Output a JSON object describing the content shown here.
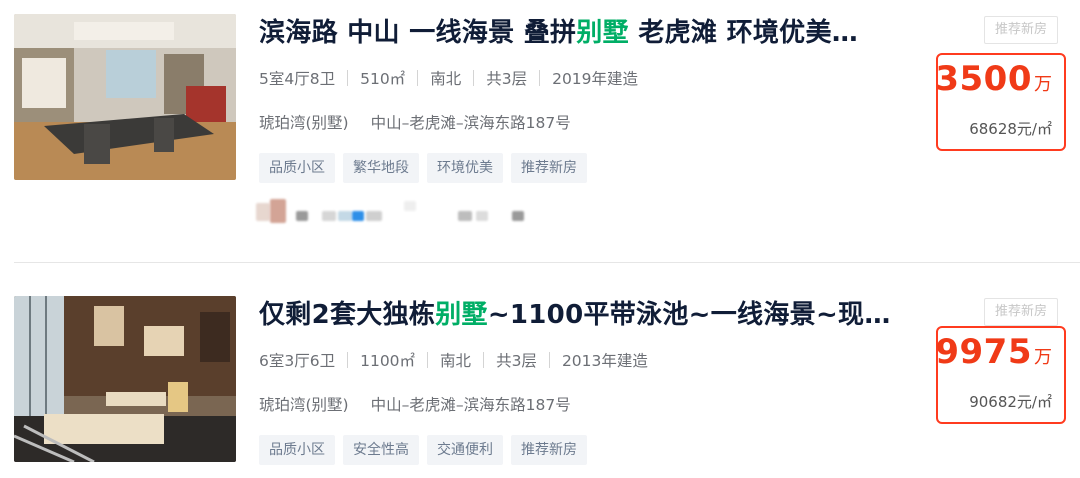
{
  "listings": [
    {
      "title_before": "滨海路 中山 一线海景 叠拼",
      "title_highlight": "别墅",
      "title_after": " 老虎滩 环境优美…",
      "badge": "推荐新房",
      "layout": "5室4厅8卫",
      "area": "510㎡",
      "orientation": "南北",
      "floors": "共3层",
      "year": "2019年建造",
      "community": "琥珀湾(别墅)",
      "location": "中山–老虎滩–滨海东路187号",
      "tags": [
        "品质小区",
        "繁华地段",
        "环境优美",
        "推荐新房"
      ],
      "total_price": "3500",
      "total_price_unit": "万",
      "unit_price": "68628元/㎡"
    },
    {
      "title_before": "仅剩2套大独栋",
      "title_highlight": "别墅",
      "title_after": "~1100平带泳池~一线海景~现…",
      "badge": "推荐新房",
      "layout": "6室3厅6卫",
      "area": "1100㎡",
      "orientation": "南北",
      "floors": "共3层",
      "year": "2013年建造",
      "community": "琥珀湾(别墅)",
      "location": "中山–老虎滩–滨海东路187号",
      "tags": [
        "品质小区",
        "安全性高",
        "交通便利",
        "推荐新房"
      ],
      "total_price": "9975",
      "total_price_unit": "万",
      "unit_price": "90682元/㎡"
    }
  ],
  "colors": {
    "title": "#101d37",
    "highlight": "#00ae66",
    "price": "#f03a17",
    "price_box_border": "#ff3b1f",
    "tag_bg": "#f2f4f7",
    "tag_text": "#6d7b8f"
  }
}
